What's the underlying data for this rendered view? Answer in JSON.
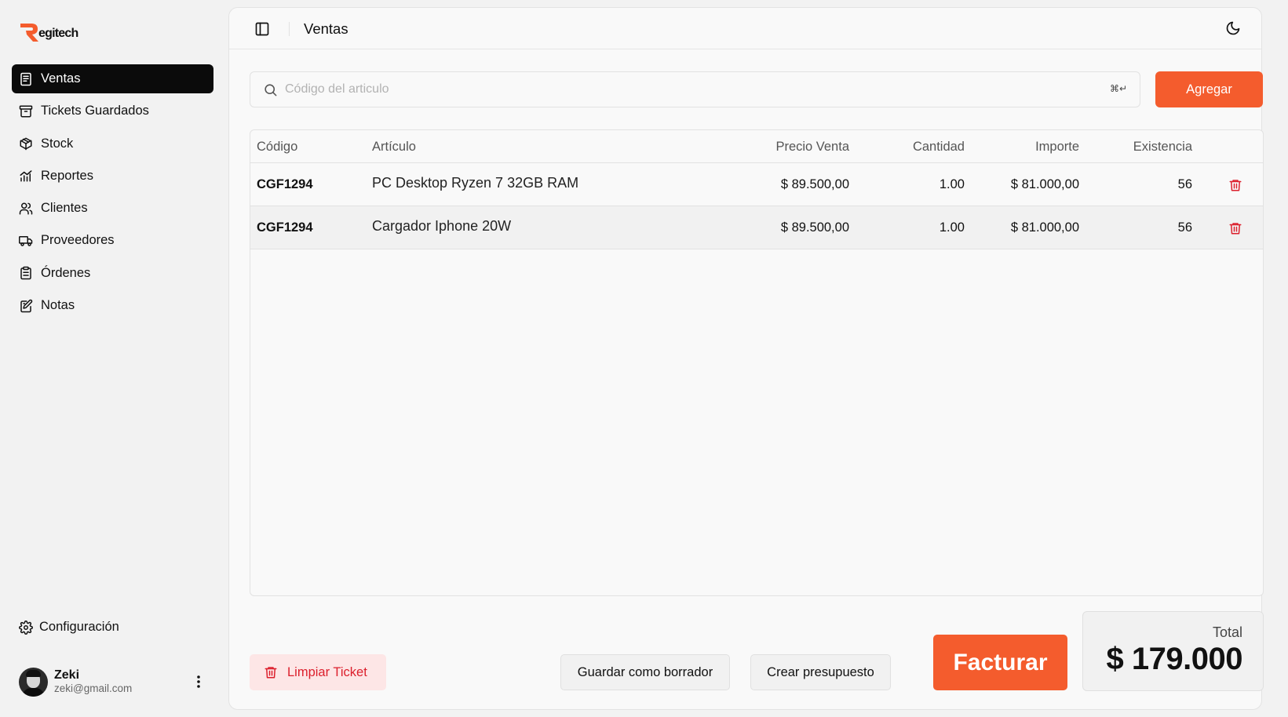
{
  "app": {
    "logo_text": "egitech"
  },
  "sidebar": {
    "items": [
      {
        "label": "Ventas",
        "icon": "receipt-icon",
        "active": true
      },
      {
        "label": "Tickets Guardados",
        "icon": "archive-icon"
      },
      {
        "label": "Stock",
        "icon": "package-icon"
      },
      {
        "label": "Reportes",
        "icon": "chart-icon"
      },
      {
        "label": "Clientes",
        "icon": "users-icon"
      },
      {
        "label": "Proveedores",
        "icon": "truck-icon"
      },
      {
        "label": "Órdenes",
        "icon": "clipboard-icon"
      },
      {
        "label": "Notas",
        "icon": "note-icon"
      }
    ],
    "config_label": "Configuración",
    "user": {
      "name": "Zeki",
      "email": "zeki@gmail.com"
    }
  },
  "header": {
    "title": "Ventas"
  },
  "search": {
    "placeholder": "Código del articulo",
    "shortcut": "⌘↵"
  },
  "add_button": "Agregar",
  "table": {
    "columns": [
      "Código",
      "Artículo",
      "Precio Venta",
      "Cantidad",
      "Importe",
      "Existencia"
    ],
    "rows": [
      {
        "code": "CGF1294",
        "article": "PC Desktop Ryzen 7 32GB RAM",
        "price": "$ 89.500,00",
        "qty": "1.00",
        "amount": "$ 81.000,00",
        "stock": "56"
      },
      {
        "code": "CGF1294",
        "article": "Cargador Iphone 20W",
        "price": "$ 89.500,00",
        "qty": "1.00",
        "amount": "$ 81.000,00",
        "stock": "56"
      }
    ]
  },
  "footer": {
    "clear_label": "Limpiar Ticket",
    "draft_label": "Guardar como borrador",
    "budget_label": "Crear presupuesto",
    "invoice_label": "Facturar",
    "total_label": "Total",
    "total_value": "$ 179.000"
  },
  "colors": {
    "accent": "#f45c2d",
    "danger": "#dc1f2c",
    "active_nav": "#0b0b0b"
  }
}
